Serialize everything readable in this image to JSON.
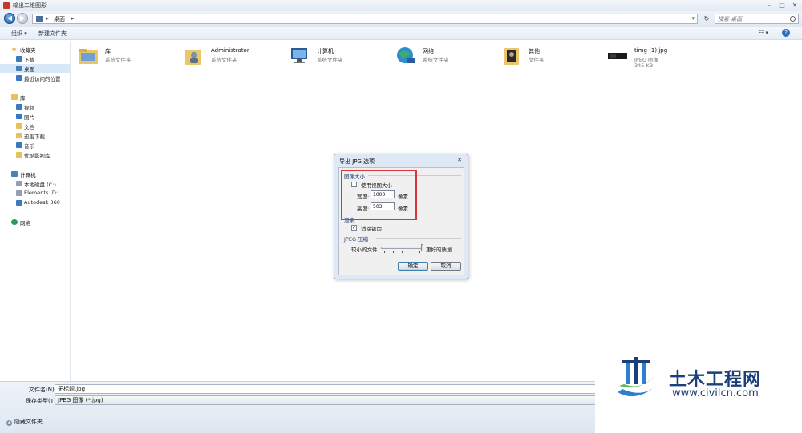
{
  "window": {
    "title": "输出二维图形"
  },
  "address": {
    "path": "桌面"
  },
  "search": {
    "placeholder": "搜索 桌面"
  },
  "toolbar": {
    "organize": "组织 ▾",
    "new_folder": "新建文件夹"
  },
  "navpane": {
    "items": [
      {
        "label": "收藏夹",
        "icon": "star-icon",
        "level": 0
      },
      {
        "label": "下载",
        "icon": "folder-icon",
        "level": 1
      },
      {
        "label": "桌面",
        "icon": "desktop-icon",
        "level": 1,
        "selected": true
      },
      {
        "label": "最近访问的位置",
        "icon": "recent-icon",
        "level": 1
      },
      {
        "label": "库",
        "icon": "library-icon",
        "level": 0
      },
      {
        "label": "视频",
        "icon": "video-icon",
        "level": 1
      },
      {
        "label": "图片",
        "icon": "picture-icon",
        "level": 1
      },
      {
        "label": "文档",
        "icon": "document-icon",
        "level": 1
      },
      {
        "label": "迅雷下载",
        "icon": "folder-icon",
        "level": 1
      },
      {
        "label": "音乐",
        "icon": "music-icon",
        "level": 1
      },
      {
        "label": "优酷影视库",
        "icon": "folder-icon",
        "level": 1
      },
      {
        "label": "计算机",
        "icon": "computer-icon",
        "level": 0
      },
      {
        "label": "本地磁盘 (C:)",
        "icon": "drive-icon",
        "level": 1
      },
      {
        "label": "Elements (D:)",
        "icon": "drive-icon",
        "level": 1
      },
      {
        "label": "Autodesk 360",
        "icon": "cloud-icon",
        "level": 1
      },
      {
        "label": "网络",
        "icon": "network-icon",
        "level": 0
      }
    ]
  },
  "files": [
    {
      "name": "库",
      "type": "系统文件夹",
      "size": "",
      "icon": "library-folder-icon"
    },
    {
      "name": "Administrator",
      "type": "系统文件夹",
      "size": "",
      "icon": "user-folder-icon"
    },
    {
      "name": "计算机",
      "type": "系统文件夹",
      "size": "",
      "icon": "computer-icon"
    },
    {
      "name": "网络",
      "type": "系统文件夹",
      "size": "",
      "icon": "network-icon"
    },
    {
      "name": "其他",
      "type": "文件夹",
      "size": "",
      "icon": "folder-icon"
    },
    {
      "name": "timg (1).jpg",
      "type": "JPEG 图像",
      "size": "345 KB",
      "icon": "image-thumbnail-icon"
    }
  ],
  "dialog": {
    "title": "导出 JPG 选项",
    "close": "✕",
    "image_size_group": "图像大小",
    "use_view_size": "使用视图大小",
    "width_label": "宽度:",
    "width_value": "1000",
    "width_unit": "像素",
    "height_label": "高度:",
    "height_value": "503",
    "height_unit": "像素",
    "render_group": "渲染",
    "antialias": "消除锯齿",
    "antialias_checked": true,
    "use_view_size_checked": false,
    "jpeg_group": "JPEG 压缩",
    "smaller_file": "较小的文件",
    "better_quality": "更好的质量",
    "ok": "确定",
    "cancel": "取消"
  },
  "bottom": {
    "filename_label": "文件名(N):",
    "filename_value": "无标题.jpg",
    "filetype_label": "保存类型(T):",
    "filetype_value": "JPEG 图像 (*.jpg)",
    "hide_folders": "隐藏文件夹"
  },
  "watermark": {
    "title": "土木工程网",
    "url": "www.civilcn.com"
  },
  "colors": {
    "accent": "#1a3f7a",
    "highlight": "#d9363a",
    "selection": "#d9e8f9"
  }
}
